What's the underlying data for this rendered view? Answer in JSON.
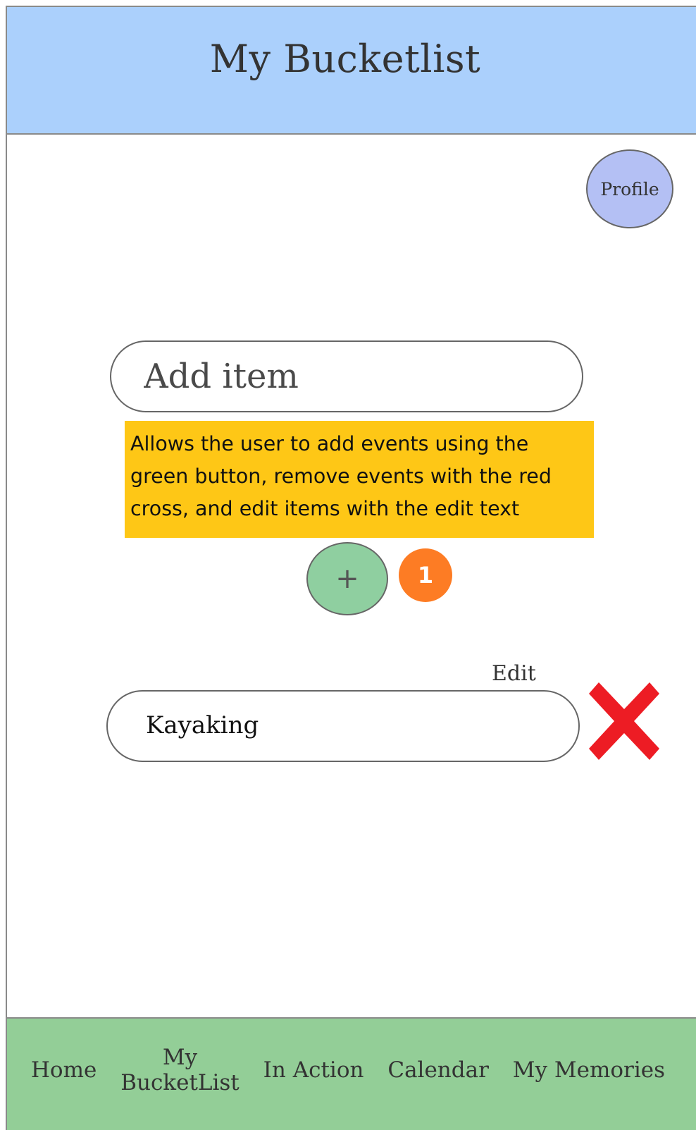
{
  "header": {
    "title": "My Bucketlist"
  },
  "profile": {
    "label": "Profile"
  },
  "add_item": {
    "placeholder": "Add item",
    "value": ""
  },
  "annotation": {
    "text": "Allows the user to add events using the green button, remove events with the red cross, and edit items with the edit text",
    "badge": "1",
    "note_color": "#fec716",
    "badge_color": "#fd7c24"
  },
  "add_button": {
    "label": "+",
    "color": "#8fcfa0"
  },
  "items": [
    {
      "label": "Kayaking",
      "edit_label": "Edit",
      "remove_icon": "red-cross-icon",
      "remove_color": "#ed1c24"
    }
  ],
  "bottom_nav": {
    "items": [
      {
        "label_line1": "Home",
        "label_line2": ""
      },
      {
        "label_line1": "My",
        "label_line2": "BucketList"
      },
      {
        "label_line1": "In Action",
        "label_line2": ""
      },
      {
        "label_line1": "Calendar",
        "label_line2": ""
      },
      {
        "label_line1": "My Memories",
        "label_line2": ""
      }
    ]
  },
  "colors": {
    "header_bg": "#abd0fc",
    "profile_bg": "#b4c0f4",
    "nav_bg": "#93ce97"
  }
}
